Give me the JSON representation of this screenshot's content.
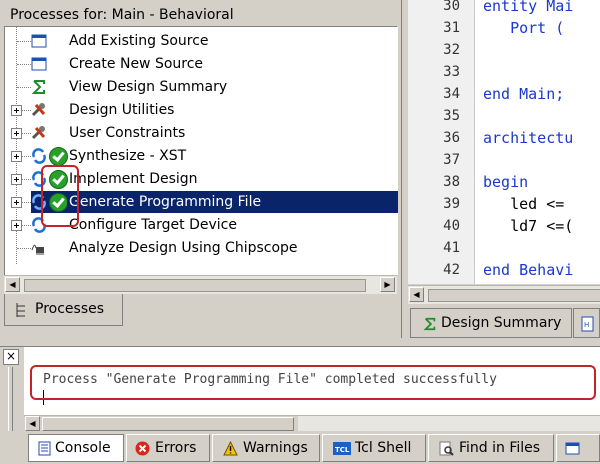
{
  "processes": {
    "title": "Processes for: Main - Behavioral",
    "items": [
      {
        "label": "Add Existing Source",
        "icon": "window-icon"
      },
      {
        "label": "Create New Source",
        "icon": "window-icon"
      },
      {
        "label": "View Design Summary",
        "icon": "sigma-icon"
      },
      {
        "label": "Design Utilities",
        "icon": "tools-icon"
      },
      {
        "label": "User Constraints",
        "icon": "tools-icon"
      },
      {
        "label": "Synthesize - XST",
        "icon": "process-run-icon",
        "status": "completed"
      },
      {
        "label": "Implement Design",
        "icon": "process-run-icon",
        "status": "completed"
      },
      {
        "label": "Generate Programming File",
        "icon": "process-run-icon",
        "status": "completed",
        "selected": true
      },
      {
        "label": "Configure Target Device",
        "icon": "process-run-icon"
      },
      {
        "label": "Analyze Design Using Chipscope",
        "icon": "chipscope-icon"
      }
    ],
    "tab_label": "Processes"
  },
  "editor": {
    "lines": [
      {
        "num": "30",
        "text": "entity Mai"
      },
      {
        "num": "31",
        "text": "   Port ("
      },
      {
        "num": "32",
        "text": ""
      },
      {
        "num": "33",
        "text": ""
      },
      {
        "num": "34",
        "text": "end Main;"
      },
      {
        "num": "35",
        "text": ""
      },
      {
        "num": "36",
        "text": "architectu"
      },
      {
        "num": "37",
        "text": ""
      },
      {
        "num": "38",
        "text": "begin"
      },
      {
        "num": "39",
        "text": "   led <="
      },
      {
        "num": "40",
        "text": "   ld7 <=("
      },
      {
        "num": "41",
        "text": ""
      },
      {
        "num": "42",
        "text": "end Behavi"
      }
    ],
    "tab_label": "Design Summary"
  },
  "console": {
    "message": "Process \"Generate Programming File\" completed successfully",
    "close_glyph": "×",
    "tabs": [
      {
        "label": "Console",
        "icon": "console-icon"
      },
      {
        "label": "Errors",
        "icon": "error-icon"
      },
      {
        "label": "Warnings",
        "icon": "warning-icon"
      },
      {
        "label": "Tcl Shell",
        "icon": "tcl-icon",
        "icon_text": "TCL"
      },
      {
        "label": "Find in Files",
        "icon": "find-icon"
      }
    ]
  },
  "colors": {
    "selection": "#0a246a",
    "annotation": "#c3232b",
    "keyword": "#1a37d0",
    "success": "#27a12a"
  }
}
